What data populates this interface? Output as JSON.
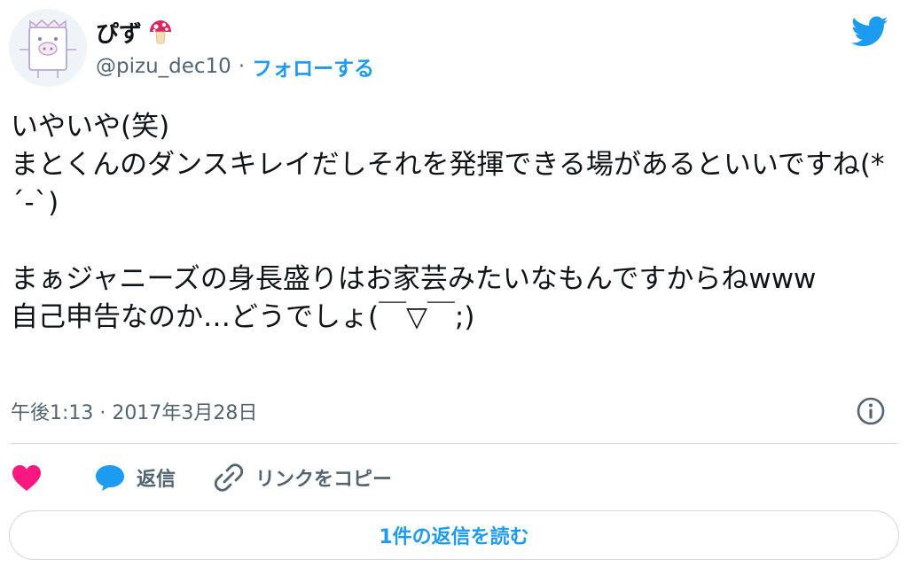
{
  "author": {
    "display_name": "ぴず",
    "display_name_emoji": "mushroom-icon",
    "handle": "@pizu_dec10",
    "separator": "·",
    "follow_label": "フォローする"
  },
  "tweet": {
    "text": "いやいや(笑)\nまとくんのダンスキレイだしそれを発揮できる場があるといいですね(*´-`)\n\nまぁジャニーズの身長盛りはお家芸みたいなもんですからねwww\n自己申告なのか…どうでしょ(￣▽￣;)",
    "timestamp": "午後1:13 · 2017年3月28日"
  },
  "actions": {
    "like_icon": "heart-icon",
    "reply_label": "返信",
    "copy_link_label": "リンクをコピー"
  },
  "read_replies_label": "1件の返信を読む",
  "colors": {
    "accent": "#1d9bf0",
    "heart": "#f91880",
    "text": "#0f1419",
    "secondary": "#536471",
    "border": "#cfd9de"
  }
}
